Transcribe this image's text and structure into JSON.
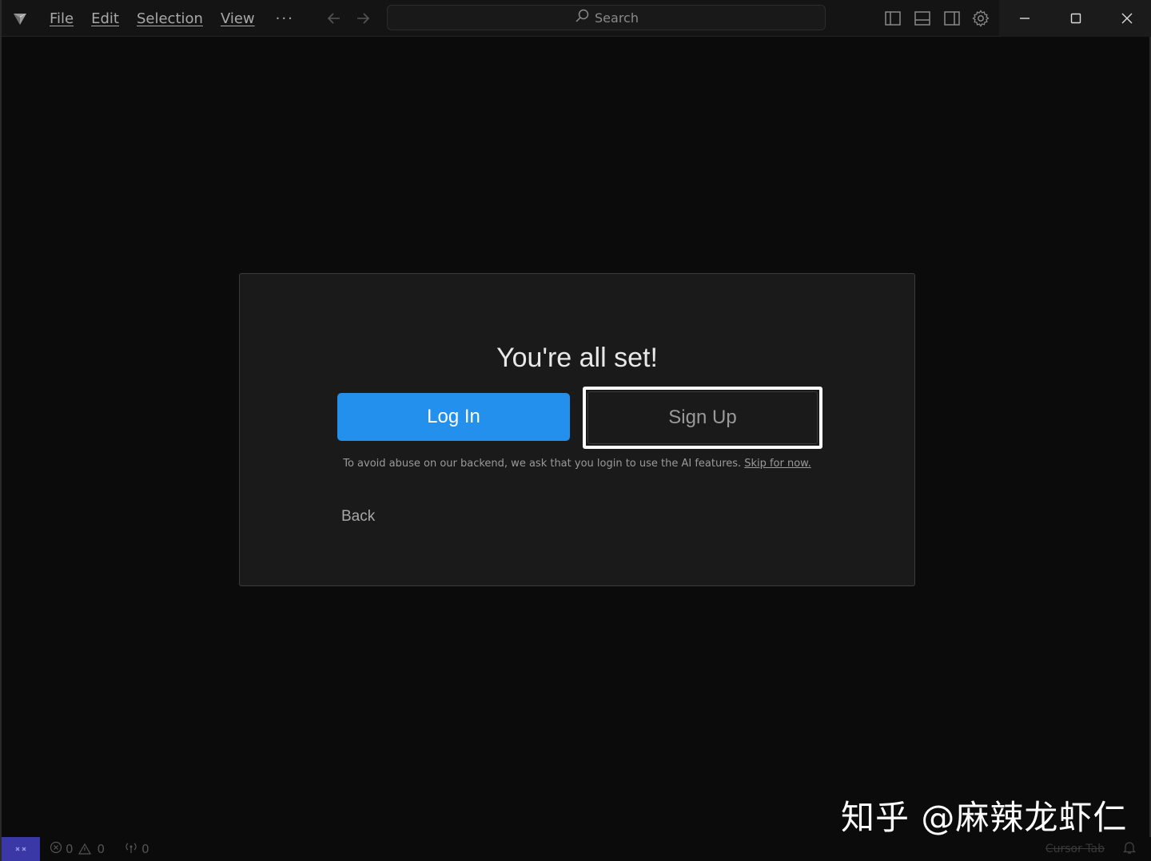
{
  "titlebar": {
    "menu": [
      "File",
      "Edit",
      "Selection",
      "View"
    ],
    "more": "···",
    "search_placeholder": "Search"
  },
  "dialog": {
    "title": "You're all set!",
    "login_label": "Log In",
    "signup_label": "Sign Up",
    "notice_text": "To avoid abuse on our backend, we ask that you login to use the AI features.",
    "skip_label": "Skip for now.",
    "back_label": "Back"
  },
  "statusbar": {
    "errors": "0",
    "warnings": "0",
    "ports": "0",
    "cursor_tab": "Cursor Tab"
  },
  "watermark": "知乎 @麻辣龙虾仁",
  "colors": {
    "accent": "#2490ed",
    "remote": "#3a38a6",
    "background": "#0b0b0b",
    "dialog": "#1a1a1a"
  }
}
